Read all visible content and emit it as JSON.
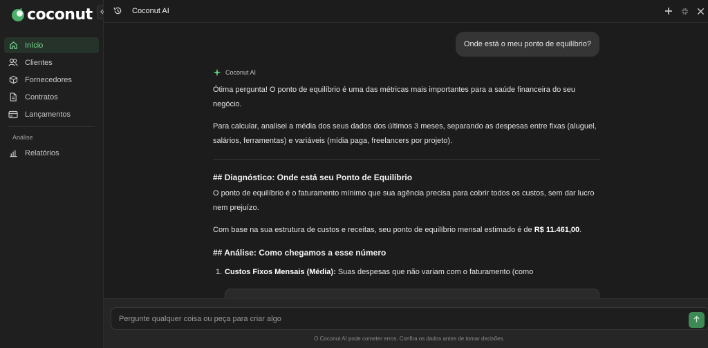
{
  "brand": {
    "name": "coconut",
    "accent": "#4caf6a"
  },
  "sidebar": {
    "items": [
      {
        "label": "Início",
        "icon": "home-icon",
        "active": true
      },
      {
        "label": "Clientes",
        "icon": "users-icon"
      },
      {
        "label": "Fornecedores",
        "icon": "box-icon"
      },
      {
        "label": "Contratos",
        "icon": "document-icon"
      },
      {
        "label": "Lançamentos",
        "icon": "card-icon"
      }
    ],
    "section_label": "Análise",
    "section_items": [
      {
        "label": "Relatórios",
        "icon": "bar-chart-icon"
      }
    ]
  },
  "topbar": {
    "title": "Coconut AI"
  },
  "chat": {
    "user_message": "Onde está o meu ponto de equilíbrio?",
    "ai_name": "Coconut AI",
    "p1": "Ótima pergunta! O ponto de equilíbrio é uma das métricas mais importantes para a saúde financeira do seu negócio.",
    "p2": "Para calcular, analisei a média dos seus dados dos últimos 3 meses, separando as despesas entre fixas (aluguel, salários, ferramentas) e variáveis (mídia paga, freelancers por projeto).",
    "h1": "## Diagnóstico: Onde está seu Ponto de Equilíbrio",
    "p3": "O ponto de equilíbrio é o faturamento mínimo que sua agência precisa para cobrir todos os custos, sem dar lucro nem prejuízo.",
    "p4_prefix": "Com base na sua estrutura de custos e receitas, seu ponto de equilíbrio mensal estimado é de ",
    "p4_value": "R$ 11.461,00",
    "p4_suffix": ".",
    "h2": "## Análise: Como chegamos a esse número",
    "list_num": "1.",
    "list_bold": "Custos Fixos Mensais (Média):",
    "list_text": " Suas despesas que não variam com o faturamento (como"
  },
  "composer": {
    "placeholder": "Pergunte qualquer coisa ou peça para criar algo",
    "disclaimer": "O Coconut AI pode cometer erros. Confira os dados antes de tomar decisões."
  }
}
